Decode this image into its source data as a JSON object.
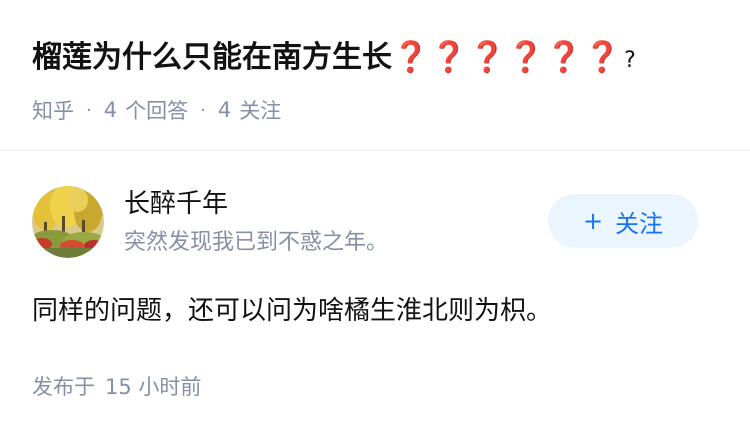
{
  "question": {
    "title": "榴莲为什么只能在南方生长",
    "title_marks": "❓❓❓❓❓❓",
    "title_tail": "?"
  },
  "meta": {
    "source": "知乎",
    "separator": "·",
    "answer_count": "4",
    "answer_label": "个回答",
    "follower_count": "4",
    "follower_label": "关注"
  },
  "author": {
    "name": "长醉千年",
    "bio": "突然发现我已到不惑之年。",
    "avatar_icon": "autumn-trees-avatar"
  },
  "follow_button": {
    "plus": "+",
    "label": "关注"
  },
  "answer": {
    "text": "同样的问题，还可以问为啥橘生淮北则为枳。"
  },
  "posted": {
    "label": "发布于",
    "time": "15 小时前"
  },
  "colors": {
    "title": "#121212",
    "meta": "#8590a6",
    "question_mark_red": "#e5212b",
    "follow_bg": "#ebf5fd",
    "follow_text": "#1772f6",
    "divider": "#ebebeb"
  }
}
